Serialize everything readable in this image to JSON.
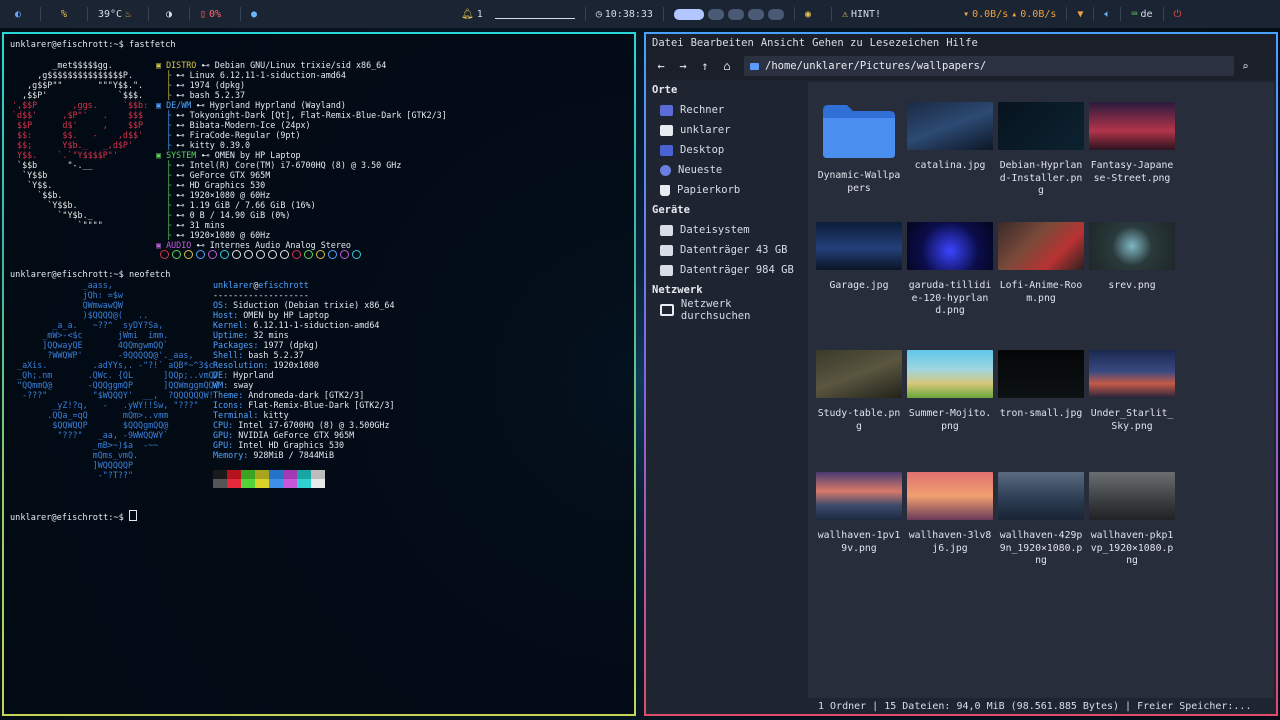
{
  "topbar": {
    "temp": "39°C",
    "cpu_percent": "0%",
    "notif_count": "1",
    "clock": "10:38:33",
    "hint": "HINT!",
    "net_down": "0.0B/s",
    "net_up": "0.0B/s",
    "keyboard": "de",
    "icons": [
      "debian-icon",
      "percent-icon",
      "thermometer-icon",
      "moon-icon",
      "battery-icon",
      "circle-icon",
      "bell-icon",
      "clock-icon",
      "workspaces",
      "idle-icon",
      "warning-icon",
      "network-icon",
      "volume-icon",
      "keyboard-icon",
      "power-icon"
    ]
  },
  "terminal": {
    "prompt": "unklarer@efischrott:~$",
    "cmd1": "fastfetch",
    "cmd2": "neofetch",
    "fastfetch_ascii": [
      "        _met$$$$$gg.",
      "     ,g$$$$$$$$$$$$$$$P.",
      "   ,g$$P\"\"       \"\"\"Y$$.\".",
      "  ,$$P'              `$$$.",
      "',$$P       ,ggs.     `$$b:",
      "`d$$'     ,$P\"'   .    $$$",
      " $$P      d$'     ,    $$P",
      " $$:      $$.   -    ,d$$'",
      " $$;      Y$b._   _,d$P'",
      " Y$$.    `.`\"Y$$$$P\"'",
      " `$$b      \"-.__",
      "  `Y$$b",
      "   `Y$$.",
      "     `$$b.",
      "       `Y$$b.",
      "         `\"Y$b._",
      "             `\"\"\"\""
    ],
    "fastfetch_info": [
      {
        "key": "DISTRO",
        "val": "Debian GNU/Linux trixie/sid x86_64"
      },
      {
        "key": "",
        "val": "Linux 6.12.11-1-siduction-amd64"
      },
      {
        "key": "",
        "val": "1974 (dpkg)"
      },
      {
        "key": "",
        "val": "bash 5.2.37"
      },
      {
        "key": "DE/WM",
        "val": "Hyprland Hyprland (Wayland)"
      },
      {
        "key": "",
        "val": "Tokyonight-Dark [Qt], Flat-Remix-Blue-Dark [GTK2/3]"
      },
      {
        "key": "",
        "val": "Bibata-Modern-Ice (24px)"
      },
      {
        "key": "",
        "val": "FiraCode-Regular (9pt)"
      },
      {
        "key": "",
        "val": "kitty 0.39.0"
      },
      {
        "key": "SYSTEM",
        "val": "OMEN by HP Laptop"
      },
      {
        "key": "",
        "val": "Intel(R) Core(TM) i7-6700HQ (8) @ 3.50 GHz"
      },
      {
        "key": "",
        "val": "GeForce GTX 965M"
      },
      {
        "key": "",
        "val": "HD Graphics 530"
      },
      {
        "key": "",
        "val": "1920×1080 @ 60Hz"
      },
      {
        "key": "",
        "val": "1.19 GiB / 7.66 GiB (16%)"
      },
      {
        "key": "",
        "val": "0 B / 14.90 GiB (0%)"
      },
      {
        "key": "",
        "val": "31 mins"
      },
      {
        "key": "",
        "val": "1920×1080 @ 60Hz"
      },
      {
        "key": "AUDIO",
        "val": "Internes Audio Analog Stereo"
      }
    ],
    "neofetch_ascii": [
      "              _aass,",
      "              jQh: =$w",
      "              QWmwawQW",
      "              )$QQQQ@(   ..",
      "        _a_a.   ~??^  syDY?Sa,",
      "      _mW>-<$c       jWmi  imm.",
      "      ]QQwayQE       4QQmgwmQQ`",
      "       ?WWQWP'       -9QQQQQ@'._aas,",
      " _aXis.         .adYYs,. -\"?!` aQB*~^3$c",
      " _Qh;.nm       .QWc. {QL      ]QQp;..vmQ/",
      " \"QQmmQ@       -QQQggmQP      ]QQWmggmQQ(",
      "  -???\"         \"$WQQQY'  __,  ?QQQQQQW!",
      "        _yZ!?q,   -   .yWY!!Sw, \"???\"",
      "       .QQa_=qQ       mQm>..vmm",
      "        $QQWQQP       $QQQgmQQ@",
      "         \"???\"   _aa, -9WWQQWY`",
      "                _mB>~)$a  -~~",
      "                mQms_vmQ.",
      "                ]WQQQQQP",
      "                 -\"?T??\""
    ],
    "neofetch_user": "unklarer",
    "neofetch_host": "efischrott",
    "neofetch_info": [
      {
        "key": "OS",
        "val": "Siduction (Debian trixie) x86_64"
      },
      {
        "key": "Host",
        "val": "OMEN by HP Laptop"
      },
      {
        "key": "Kernel",
        "val": "6.12.11-1-siduction-amd64"
      },
      {
        "key": "Uptime",
        "val": "32 mins"
      },
      {
        "key": "Packages",
        "val": "1977 (dpkg)"
      },
      {
        "key": "Shell",
        "val": "bash 5.2.37"
      },
      {
        "key": "Resolution",
        "val": "1920x1080"
      },
      {
        "key": "DE",
        "val": "Hyprland"
      },
      {
        "key": "WM",
        "val": "sway"
      },
      {
        "key": "Theme",
        "val": "Andromeda-dark [GTK2/3]"
      },
      {
        "key": "Icons",
        "val": "Flat-Remix-Blue-Dark [GTK2/3]"
      },
      {
        "key": "Terminal",
        "val": "kitty"
      },
      {
        "key": "CPU",
        "val": "Intel i7-6700HQ (8) @ 3.500GHz"
      },
      {
        "key": "GPU",
        "val": "NVIDIA GeForce GTX 965M"
      },
      {
        "key": "GPU",
        "val": "Intel HD Graphics 530"
      },
      {
        "key": "Memory",
        "val": "928MiB / 7844MiB"
      }
    ],
    "dot_colors": [
      "#d7334b",
      "#5fd35f",
      "#d4c046",
      "#4fa3ff",
      "#c05cd8",
      "#38c8d8",
      "#e6e6e6",
      "#e6e6e6",
      "#e6e6e6",
      "#e6e6e6",
      "#e6e6e6",
      "#d7334b",
      "#5fd35f",
      "#d4c046",
      "#4fa3ff",
      "#c05cd8",
      "#38c8d8"
    ],
    "palette_colors": [
      "#1a1a1a",
      "#b4121f",
      "#3aa321",
      "#a9a41d",
      "#2573c9",
      "#a23bb3",
      "#1aa5a5",
      "#bdbdbd",
      "#555555",
      "#e6283b",
      "#54d23a",
      "#d9d22a",
      "#3f8fe8",
      "#c957d9",
      "#2ed0d0",
      "#e8e8e8"
    ]
  },
  "filemanager": {
    "menu": [
      "Datei",
      "Bearbeiten",
      "Ansicht",
      "Gehen zu",
      "Lesezeichen",
      "Hilfe"
    ],
    "path": "/home/unklarer/Pictures/wallpapers/",
    "sidebar": {
      "places_header": "Orte",
      "places": [
        {
          "label": "Rechner",
          "icon": "computer-icon",
          "color": "#5b6bd8"
        },
        {
          "label": "unklarer",
          "icon": "home-folder-icon",
          "color": "#e8ecf2"
        },
        {
          "label": "Desktop",
          "icon": "desktop-icon",
          "color": "#4a63d4"
        },
        {
          "label": "Neueste",
          "icon": "recent-icon",
          "color": "#6b7fe0"
        },
        {
          "label": "Papierkorb",
          "icon": "trash-icon",
          "color": "#e8ecf2"
        }
      ],
      "devices_header": "Geräte",
      "devices": [
        {
          "label": "Dateisystem",
          "icon": "drive-icon"
        },
        {
          "label": "Datenträger 43 GB",
          "icon": "drive-icon"
        },
        {
          "label": "Datenträger 984 GB",
          "icon": "drive-icon"
        }
      ],
      "network_header": "Netzwerk",
      "network": [
        {
          "label": "Netzwerk durchsuchen",
          "icon": "network-browse-icon"
        }
      ]
    },
    "files": [
      {
        "name": "Dynamic-Wallpapers",
        "type": "folder"
      },
      {
        "name": "catalina.jpg",
        "bg": "linear-gradient(160deg,#1b2a44,#2c4a73 50%,#0d1626)"
      },
      {
        "name": "Debian-Hyprland-Installer.png",
        "bg": "linear-gradient(135deg,#07141f,#0c2230)"
      },
      {
        "name": "Fantasy-Japanese-Street.png",
        "bg": "linear-gradient(180deg,#2a1a3e,#b2344a 60%,#2a1320)"
      },
      {
        "name": "Garage.jpg",
        "bg": "linear-gradient(180deg,#0c1c3a,#23407a 55%,#0a1426)"
      },
      {
        "name": "garuda-tillidie-120-hyprland.png",
        "bg": "radial-gradient(circle at 50% 60%,#3b44ff,#0b0d4a 55%,#04051c)"
      },
      {
        "name": "Lofi-Anime-Room.png",
        "bg": "linear-gradient(135deg,#3a2a2a,#7a4a3a 40%,#b83232 70%,#2b2020)"
      },
      {
        "name": "srev.png",
        "bg": "radial-gradient(circle at 50% 50%,#7fb7c2,#2a3a3c 40%,#1e2628)"
      },
      {
        "name": "Study-table.png",
        "bg": "linear-gradient(160deg,#3a3a2a,#5a5640 50%,#22221a)"
      },
      {
        "name": "Summer-Mojito.png",
        "bg": "linear-gradient(180deg,#5fc6e8,#9fd6e0 40%,#d6c67a 70%,#6aa63a)"
      },
      {
        "name": "tron-small.jpg",
        "bg": "linear-gradient(180deg,#050607,#0c1112)"
      },
      {
        "name": "Under_Starlit_Sky.png",
        "bg": "linear-gradient(180deg,#1a2850,#3a4a80 45%,#c55a48 70%,#23243a)"
      },
      {
        "name": "wallhaven-1pv19v.png",
        "bg": "linear-gradient(180deg,#4a3a70,#d67a6a 40%,#3a4a6a 70%,#1e2a40)"
      },
      {
        "name": "wallhaven-3lv8j6.jpg",
        "bg": "linear-gradient(180deg,#e07070,#f0a070 50%,#6a3a5a)"
      },
      {
        "name": "wallhaven-429p9n_1920×1080.png",
        "bg": "linear-gradient(180deg,#5a6a80,#2a3a50 60%,#1a2434)"
      },
      {
        "name": "wallhaven-pkp1vp_1920×1080.png",
        "bg": "linear-gradient(180deg,#6a6e70,#3a3e40 60%,#202224)"
      }
    ],
    "status": "1 Ordner  |  15 Dateien: 94,0 MiB (98.561.885 Bytes)  |  Freier Speicher:..."
  }
}
